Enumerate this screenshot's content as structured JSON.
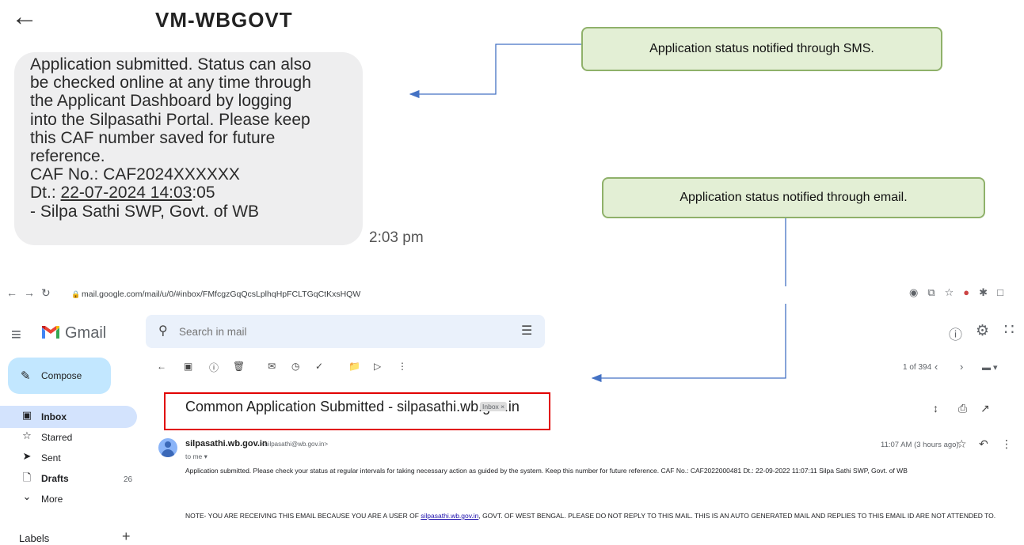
{
  "sms": {
    "back_icon": "back-arrow-icon",
    "sender": "VM-WBGOVT",
    "lines": [
      "Application submitted. Status can also",
      "be checked online at any time through",
      "the Applicant Dashboard by logging",
      "into the Silpasathi Portal. Please keep",
      "this CAF number saved for future",
      "reference.",
      "CAF No.: CAF2024XXXXXX"
    ],
    "date_prefix": "Dt.: ",
    "date_link": "22-07-2024 14:03",
    "date_suffix": ":05",
    "signature": "- Silpa Sathi SWP, Govt. of WB",
    "time": "2:03 pm"
  },
  "callouts": {
    "sms": "Application status notified through SMS.",
    "email": "Application status notified through email."
  },
  "browser": {
    "url": "mail.google.com/mail/u/0/#inbox/FMfcgzGqQcsLplhqHpFCLTGqCtKxsHQW"
  },
  "gmail": {
    "brand": "Gmail",
    "search_placeholder": "Search in mail",
    "compose": "Compose",
    "sidebar": [
      {
        "label": "Inbox",
        "icon": "inbox-icon",
        "count": ""
      },
      {
        "label": "Starred",
        "icon": "star-icon",
        "count": ""
      },
      {
        "label": "Sent",
        "icon": "send-icon",
        "count": ""
      },
      {
        "label": "Drafts",
        "icon": "draft-icon",
        "count": "26"
      },
      {
        "label": "More",
        "icon": "chevron-down-icon",
        "count": ""
      }
    ],
    "labels_heading": "Labels",
    "pager": "1 of 394",
    "subject": "Common Application Submitted - silpasathi.wb.gov.in",
    "inbox_chip": "Inbox ×",
    "from_name": "silpasathi.wb.gov.in",
    "from_email": "<silpasathi@wb.gov.in>",
    "to": "to me ▾",
    "time": "11:07 AM (3 hours ago)",
    "body": "Application submitted. Please check your status at regular intervals for taking necessary action as guided by the system. Keep this number for future reference. CAF No.: CAF2022000481 Dt.: 22-09-2022 11:07:11 Silpa Sathi SWP, Govt. of WB",
    "note_prefix": "NOTE- YOU ARE RECEIVING THIS EMAIL BECAUSE YOU ARE A USER OF ",
    "note_link": "silpasathi.wb.gov.in",
    "note_suffix": ", GOVT. OF WEST BENGAL. PLEASE DO NOT REPLY TO THIS MAIL. THIS IS AN AUTO GENERATED MAIL AND REPLIES TO THIS EMAIL ID ARE NOT ATTENDED TO."
  },
  "colors": {
    "callout_fill": "#e3efd5",
    "callout_border": "#8fb16a",
    "arrow": "#4472c4",
    "highlight": "#e10000",
    "compose_fill": "#c2e7ff"
  }
}
